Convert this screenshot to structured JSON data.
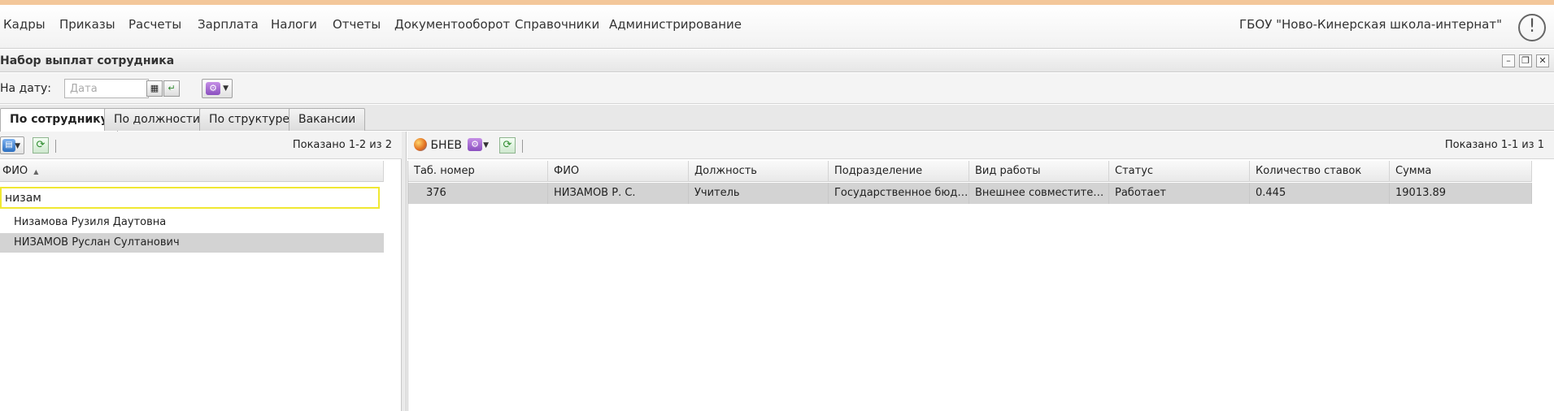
{
  "menu": {
    "items": [
      "Кадры",
      "Приказы",
      "Расчеты",
      "Зарплата",
      "Налоги",
      "Отчеты",
      "Документооборот",
      "Справочники",
      "Администрирование"
    ],
    "organization": "ГБОУ \"Ново-Кинерская школа-интернат\"",
    "alert_glyph": "!"
  },
  "window": {
    "title": "Набор выплат сотрудника",
    "minimize": "–",
    "restore": "❐",
    "close": "✕"
  },
  "filter": {
    "date_label": "На дату:",
    "date_placeholder": "Дата",
    "date_value": ""
  },
  "tabs": [
    "По сотруднику",
    "По должности",
    "По структуре",
    "Вакансии"
  ],
  "left": {
    "shown_text": "Показано 1-2 из 2",
    "column_header": "ФИО",
    "sort_indicator": "▲",
    "search_value": "низам",
    "items": [
      "Низамова Рузиля Даутовна",
      "НИЗАМОВ Руслан Султанович"
    ]
  },
  "right": {
    "bnev_label": "БНЕВ",
    "shown_text": "Показано 1-1 из 1",
    "columns": [
      "Таб. номер",
      "ФИО",
      "Должность",
      "Подразделение",
      "Вид работы",
      "Статус",
      "Количество ставок",
      "Сумма"
    ],
    "rows": [
      [
        "376",
        "НИЗАМОВ Р. С.",
        "Учитель",
        "Государственное бюдж...",
        "Внешнее совместитель...",
        "Работает",
        "0.445",
        "19013.89"
      ]
    ]
  },
  "colors": {
    "accent_strip": "#f3c79a",
    "selected_row": "#d3d3d3",
    "search_border": "#f0e832"
  }
}
